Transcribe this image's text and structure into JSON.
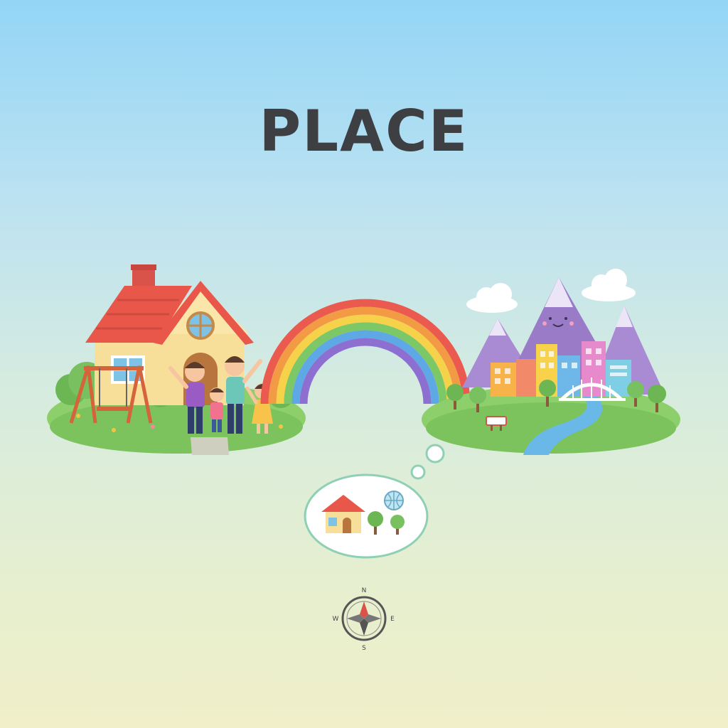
{
  "title": "PLACE",
  "compass": {
    "n": "N",
    "e": "E",
    "s": "S",
    "w": "W"
  },
  "colors": {
    "sky_top": "#93d5f6",
    "sky_bottom": "#f0efc9",
    "title": "#3d3f42",
    "grass": "#8ccf6b",
    "house_wall": "#f7df9a",
    "roof": "#e8574a",
    "mountain": "#9a7bc8",
    "river": "#6ab8e8"
  },
  "scene": {
    "left_island": "home-with-family",
    "bridge": "rainbow",
    "right_island": "city-with-mountains-and-river",
    "thought_bubble": "house-globe-trees",
    "footer_icon": "compass-rose-icon"
  }
}
